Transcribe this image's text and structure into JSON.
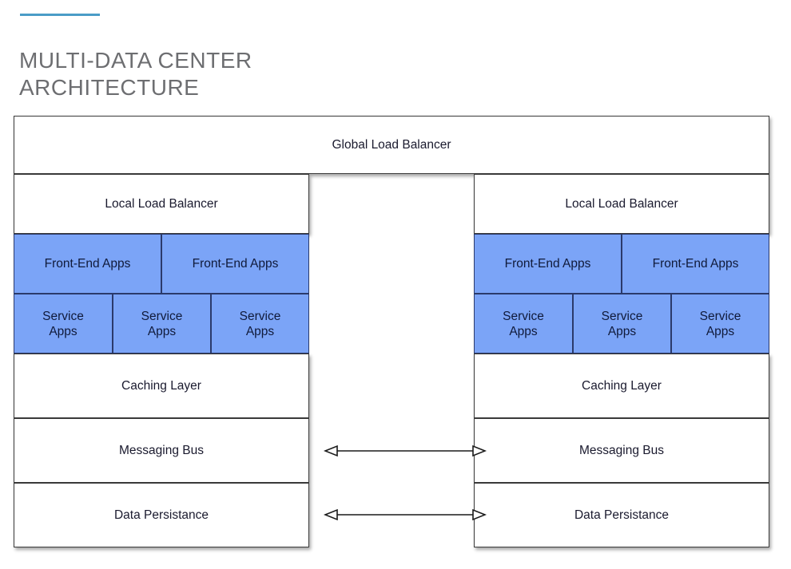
{
  "header": {
    "title": "MULTI-DATA CENTER\nARCHITECTURE",
    "accent_color": "#4a9cc7",
    "title_color": "#6d6e71"
  },
  "colors": {
    "box_fill": "#ffffff",
    "box_border": "#3a3a3a",
    "highlight_fill": "#7ba4f7",
    "highlight_border": "#2b3a6b",
    "text": "#1a1a2e"
  },
  "diagram": {
    "type": "layered-architecture",
    "global": {
      "label": "Global Load Balancer"
    },
    "datacenters": [
      {
        "side": "left",
        "rows": [
          {
            "name": "local-load-balancer",
            "cells": [
              "Local Load Balancer"
            ],
            "highlight": false
          },
          {
            "name": "front-end-apps",
            "cells": [
              "Front-End Apps",
              "Front-End Apps"
            ],
            "highlight": true
          },
          {
            "name": "service-apps",
            "cells": [
              "Service\nApps",
              "Service\nApps",
              "Service\nApps"
            ],
            "highlight": true
          },
          {
            "name": "caching-layer",
            "cells": [
              "Caching Layer"
            ],
            "highlight": false
          },
          {
            "name": "messaging-bus",
            "cells": [
              "Messaging Bus"
            ],
            "highlight": false
          },
          {
            "name": "data-persistance",
            "cells": [
              "Data Persistance"
            ],
            "highlight": false
          }
        ]
      },
      {
        "side": "right",
        "rows": [
          {
            "name": "local-load-balancer",
            "cells": [
              "Local Load Balancer"
            ],
            "highlight": false
          },
          {
            "name": "front-end-apps",
            "cells": [
              "Front-End Apps",
              "Front-End Apps"
            ],
            "highlight": true
          },
          {
            "name": "service-apps",
            "cells": [
              "Service\nApps",
              "Service\nApps",
              "Service\nApps"
            ],
            "highlight": true
          },
          {
            "name": "caching-layer",
            "cells": [
              "Caching Layer"
            ],
            "highlight": false
          },
          {
            "name": "messaging-bus",
            "cells": [
              "Messaging Bus"
            ],
            "highlight": false
          },
          {
            "name": "data-persistance",
            "cells": [
              "Data Persistance"
            ],
            "highlight": false
          }
        ]
      }
    ],
    "connectors": [
      {
        "name": "messaging-bus-link",
        "level": "messaging-bus",
        "direction": "bidirectional"
      },
      {
        "name": "data-persistance-link",
        "level": "data-persistance",
        "direction": "bidirectional"
      }
    ]
  }
}
